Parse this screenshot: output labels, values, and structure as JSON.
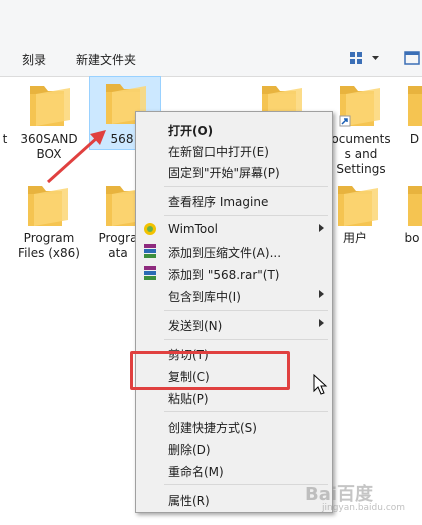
{
  "toolbar": {
    "burn": "刻录",
    "new_folder": "新建文件夹"
  },
  "folders": [
    {
      "name": "t"
    },
    {
      "name": "360SAND\nBOX"
    },
    {
      "name": "568"
    },
    {
      "name": "ocuments\ns and\nSettings"
    },
    {
      "name": "D"
    },
    {
      "name": "Program\nFiles (x86)"
    },
    {
      "name": "Progra\nata"
    },
    {
      "name": "用户"
    },
    {
      "name": "bo"
    }
  ],
  "context_menu": {
    "items": [
      {
        "label": "打开(O)",
        "bold": true
      },
      {
        "label": "在新窗口中打开(E)"
      },
      {
        "label": "固定到\"开始\"屏幕(P)"
      },
      {
        "label": "查看程序 Imagine"
      },
      {
        "label": "WimTool",
        "icon": "wimtool-icon",
        "submenu": true
      },
      {
        "label": "添加到压缩文件(A)...",
        "icon": "winrar-icon"
      },
      {
        "label": "添加到 \"568.rar\"(T)",
        "icon": "winrar-icon"
      },
      {
        "label": "包含到库中(I)",
        "submenu": true
      },
      {
        "label": "发送到(N)",
        "submenu": true
      },
      {
        "label": "剪切(T)"
      },
      {
        "label": "复制(C)"
      },
      {
        "label": "粘贴(P)"
      },
      {
        "label": "创建快捷方式(S)"
      },
      {
        "label": "删除(D)"
      },
      {
        "label": "重命名(M)"
      },
      {
        "label": "属性(R)"
      }
    ]
  },
  "watermark": {
    "text": "Bai百度",
    "sub": "jingyan.baidu.com"
  },
  "colors": {
    "folder_yellow": "#f5c451",
    "highlight_red": "#e0403f",
    "selection_blue": "#cce8ff",
    "menu_bg": "#f0f0f0"
  }
}
